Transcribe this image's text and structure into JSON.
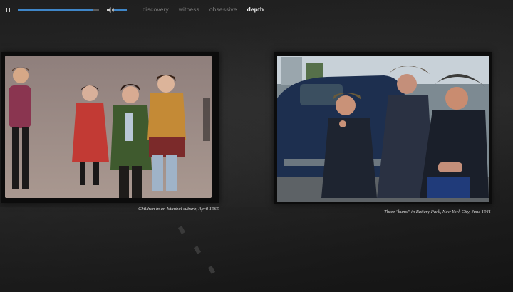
{
  "player": {
    "progress": 0.92,
    "volume": 1.0
  },
  "nav": {
    "items": [
      {
        "label": "discovery",
        "active": false
      },
      {
        "label": "witness",
        "active": false
      },
      {
        "label": "obsessive",
        "active": false
      },
      {
        "label": "depth",
        "active": true
      }
    ]
  },
  "photos": [
    {
      "caption": "Children in an Istanbul suburb, April 1965"
    },
    {
      "caption": "Three \"bums\" in Battery Park, New York City, June 1941"
    }
  ],
  "colors": {
    "accent": "#3f86c8",
    "nav_inactive": "#7a7a7a",
    "nav_active": "#f2f2f2"
  },
  "icons": {
    "play_control": "pause-icon",
    "volume": "speaker-icon"
  }
}
